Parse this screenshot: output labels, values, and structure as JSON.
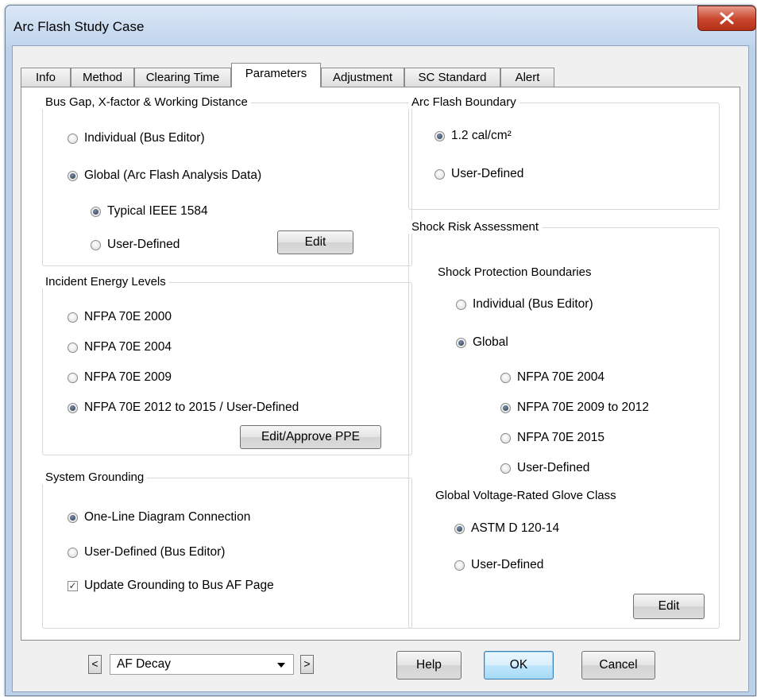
{
  "window": {
    "title": "Arc Flash Study Case"
  },
  "tabs": [
    {
      "label": "Info"
    },
    {
      "label": "Method"
    },
    {
      "label": "Clearing Time"
    },
    {
      "label": "Parameters",
      "active": true
    },
    {
      "label": "Adjustment"
    },
    {
      "label": "SC Standard"
    },
    {
      "label": "Alert"
    }
  ],
  "bus_gap": {
    "title": "Bus Gap, X-factor & Working Distance",
    "individual": "Individual (Bus Editor)",
    "global": "Global (Arc Flash Analysis Data)",
    "typical": "Typical IEEE 1584",
    "user_defined": "User-Defined",
    "edit": "Edit",
    "selected": "global",
    "global_selected": "typical"
  },
  "incident": {
    "title": "Incident Energy Levels",
    "options": [
      "NFPA 70E 2000",
      "NFPA 70E 2004",
      "NFPA 70E 2009",
      "NFPA 70E 2012 to 2015 / User-Defined"
    ],
    "selected_index": 3,
    "edit_ppe": "Edit/Approve PPE"
  },
  "grounding": {
    "title": "System Grounding",
    "one_line": "One-Line Diagram Connection",
    "user_defined": "User-Defined (Bus Editor)",
    "update": "Update Grounding to Bus AF Page",
    "selected": "one_line",
    "update_checked": true
  },
  "boundary": {
    "title": "Arc Flash Boundary",
    "cal": "1.2 cal/cm²",
    "user_defined": "User-Defined",
    "selected": "cal"
  },
  "shock": {
    "title": "Shock Risk Assessment",
    "protection_title": "Shock Protection Boundaries",
    "individual": "Individual (Bus Editor)",
    "global": "Global",
    "global_options": [
      "NFPA 70E 2004",
      "NFPA 70E 2009 to 2012",
      "NFPA 70E 2015",
      "User-Defined"
    ],
    "global_selected_index": 1,
    "glove_title": "Global Voltage-Rated Glove Class",
    "astm": "ASTM D 120-14",
    "glove_user_defined": "User-Defined",
    "edit": "Edit"
  },
  "footer": {
    "prev": "<",
    "next": ">",
    "dropdown_value": "AF Decay",
    "help": "Help",
    "ok": "OK",
    "cancel": "Cancel"
  },
  "colors": {
    "titlebar": "#bcd2ea",
    "close_button": "#c9452c",
    "dialog": "#f0f0f0",
    "default_button": "#3c7fb1"
  }
}
